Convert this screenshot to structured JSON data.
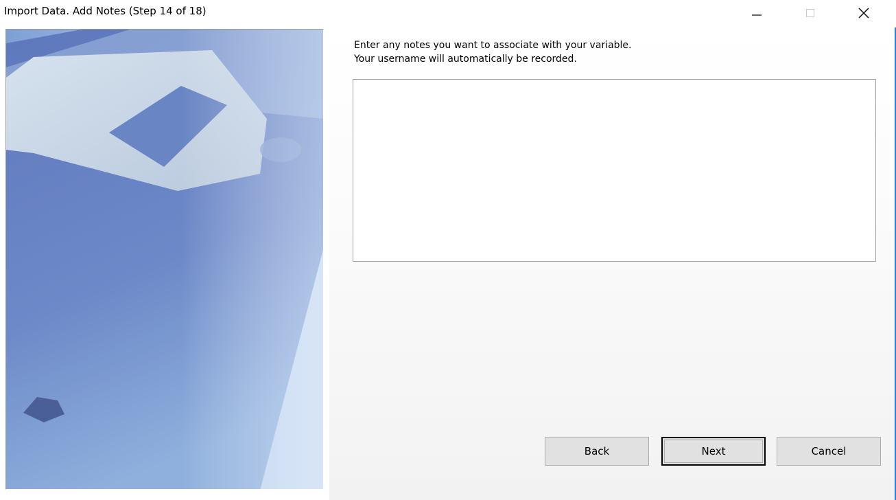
{
  "window": {
    "title": "Import Data.  Add Notes (Step 14 of 18)",
    "controls": {
      "minimize": "minimize-icon",
      "maximize": "maximize-icon",
      "close": "close-icon"
    }
  },
  "content": {
    "instruction_line1": "Enter any notes you want to associate with your variable.",
    "instruction_line2": "Your username will automatically be recorded.",
    "notes_value": ""
  },
  "buttons": {
    "back": "Back",
    "next": "Next",
    "cancel": "Cancel"
  },
  "colors": {
    "accent": "#2f7bd1",
    "panel_blue": "#6a82c2"
  }
}
